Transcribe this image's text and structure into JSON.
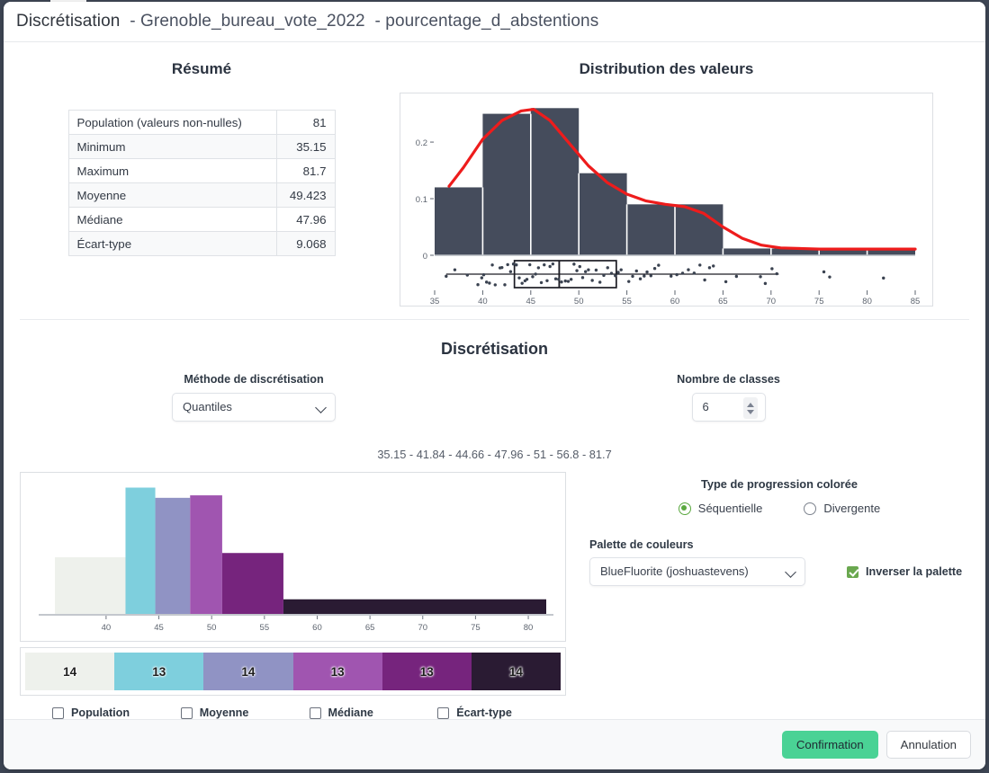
{
  "window": {
    "title_main": "Discrétisation",
    "title_layer": "- Grenoble_bureau_vote_2022",
    "title_field": "- pourcentage_d_abstentions"
  },
  "summary": {
    "heading": "Résumé",
    "rows": [
      {
        "label": "Population (valeurs non-nulles)",
        "value": "81"
      },
      {
        "label": "Minimum",
        "value": "35.15"
      },
      {
        "label": "Maximum",
        "value": "81.7"
      },
      {
        "label": "Moyenne",
        "value": "49.423"
      },
      {
        "label": "Médiane",
        "value": "47.96"
      },
      {
        "label": "Écart-type",
        "value": "9.068"
      }
    ]
  },
  "distribution": {
    "heading": "Distribution des valeurs"
  },
  "discretisation": {
    "heading": "Discrétisation",
    "method_label": "Méthode de discrétisation",
    "method_value": "Quantiles",
    "classes_label": "Nombre de classes",
    "classes_value": "6",
    "breaks_text": "35.15 - 41.84 - 44.66 - 47.96 - 51 - 56.8 - 81.7"
  },
  "progression": {
    "title": "Type de progression colorée",
    "options": [
      {
        "label": "Séquentielle",
        "selected": true
      },
      {
        "label": "Divergente",
        "selected": false
      }
    ]
  },
  "palette": {
    "label": "Palette de couleurs",
    "value": "BlueFluorite (joshuastevens)",
    "invert_label": "Inverser la palette",
    "invert_checked": true,
    "colors": [
      "#eef1ec",
      "#7ecfdd",
      "#9093c4",
      "#a055b0",
      "#76247d",
      "#2a1b33"
    ]
  },
  "class_legend": {
    "counts": [
      "14",
      "13",
      "14",
      "13",
      "13",
      "14"
    ]
  },
  "overlay_checkboxes": [
    {
      "label": "Population",
      "checked": false
    },
    {
      "label": "Moyenne",
      "checked": false
    },
    {
      "label": "Médiane",
      "checked": false
    },
    {
      "label": "Écart-type",
      "checked": false
    }
  ],
  "footer": {
    "confirm_label": "Confirmation",
    "cancel_label": "Annulation"
  },
  "chart_data": [
    {
      "type": "bar",
      "name": "distribution-histogram",
      "title": "Distribution des valeurs",
      "xlabel": "",
      "ylabel": "",
      "xlim": [
        35,
        85
      ],
      "ylim": [
        0,
        0.27
      ],
      "xticks": [
        35,
        40,
        45,
        50,
        55,
        60,
        65,
        70,
        75,
        80,
        85
      ],
      "yticks": [
        0,
        0.1,
        0.2
      ],
      "bin_edges": [
        35,
        40,
        45,
        50,
        55,
        60,
        65,
        70,
        75,
        80,
        85
      ],
      "densities": [
        0.12,
        0.25,
        0.26,
        0.145,
        0.09,
        0.09,
        0.012,
        0.012,
        0.012,
        0.012
      ],
      "bar_color": "#454c5c",
      "grid": false,
      "kde": {
        "name": "courbe de densité",
        "color": "#ee1c1c",
        "x": [
          36.5,
          38,
          40,
          42,
          44,
          45.3,
          47,
          49,
          51,
          53,
          55,
          57,
          59,
          61,
          63,
          65,
          67,
          69,
          71,
          75,
          80,
          85
        ],
        "y": [
          0.122,
          0.155,
          0.205,
          0.238,
          0.255,
          0.258,
          0.238,
          0.198,
          0.158,
          0.128,
          0.108,
          0.096,
          0.09,
          0.086,
          0.074,
          0.05,
          0.03,
          0.018,
          0.013,
          0.011,
          0.011,
          0.011
        ]
      },
      "boxplot": {
        "min": 35.15,
        "q1": 43.3,
        "median": 47.96,
        "q3": 53.9,
        "max": 81.7,
        "whisker_low": 36.2,
        "whisker_high": 70.8
      },
      "rug_points": [
        36.2,
        37.1,
        38.4,
        39.5,
        39.9,
        40.1,
        40.4,
        40.7,
        41.0,
        41.3,
        41.8,
        42.0,
        42.3,
        42.6,
        42.9,
        43.2,
        43.5,
        43.8,
        44.1,
        44.4,
        44.6,
        44.9,
        45.2,
        45.5,
        45.8,
        46.1,
        46.4,
        46.7,
        47.0,
        47.3,
        47.6,
        47.9,
        48.2,
        48.6,
        48.9,
        49.2,
        49.5,
        49.8,
        50.1,
        50.4,
        50.7,
        51.0,
        51.4,
        51.8,
        52.2,
        52.6,
        53.0,
        53.4,
        53.8,
        54.1,
        54.4,
        55.2,
        55.6,
        56.0,
        56.4,
        56.8,
        57.1,
        57.5,
        57.9,
        58.3,
        59.6,
        60.2,
        60.8,
        61.4,
        62.0,
        62.6,
        63.1,
        63.6,
        64.0,
        65.3,
        66.4,
        68.9,
        69.4,
        70.1,
        70.6,
        75.5,
        76.1,
        81.7
      ]
    },
    {
      "type": "bar",
      "name": "class-histogram",
      "title": "",
      "xlabel": "",
      "ylabel": "",
      "xlim": [
        35.15,
        81.7
      ],
      "xticks": [
        40,
        45,
        50,
        55,
        60,
        65,
        70,
        75,
        80
      ],
      "categories": [
        "35.15-41.84",
        "41.84-44.66",
        "44.66-47.96",
        "47.96-51",
        "51-56.8",
        "56.8-81.7"
      ],
      "class_breaks": [
        35.15,
        41.84,
        44.66,
        47.96,
        51,
        56.8,
        81.7
      ],
      "counts": [
        14,
        13,
        14,
        13,
        13,
        14
      ],
      "densities": [
        2.086,
        4.61,
        4.24,
        4.33,
        2.24,
        0.562
      ],
      "colors": [
        "#eef1ec",
        "#7ecfdd",
        "#9093c4",
        "#a055b0",
        "#76247d",
        "#2a1b33"
      ],
      "grid": false
    }
  ]
}
